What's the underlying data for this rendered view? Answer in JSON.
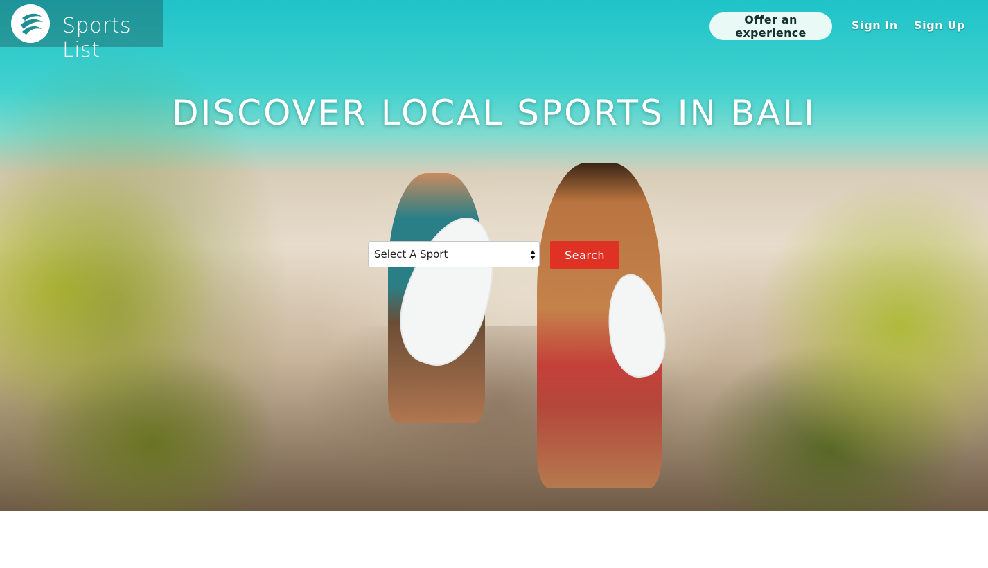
{
  "brand": {
    "name": "Sports List",
    "logo_icon": "wave-logo-icon",
    "logo_color": "#1f8f95"
  },
  "nav": {
    "offer_label": "Offer an experience",
    "signin_label": "Sign In",
    "signup_label": "Sign Up"
  },
  "hero": {
    "headline": "DISCOVER LOCAL SPORTS IN BALI"
  },
  "search": {
    "select_value": "Select A Sport",
    "button_label": "Search",
    "button_color": "#df3225"
  }
}
